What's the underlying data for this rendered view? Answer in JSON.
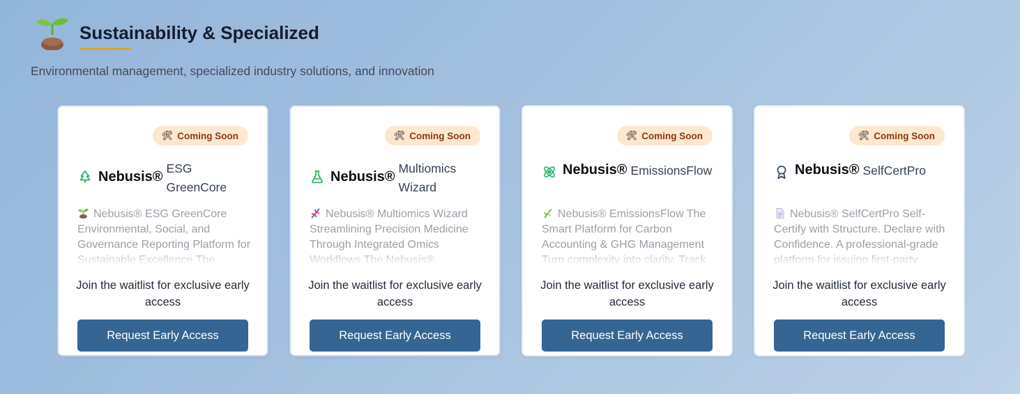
{
  "section": {
    "icon": "sprout-icon",
    "title": "Sustainability & Specialized",
    "subtitle": "Environmental management, specialized industry solutions, and innovation",
    "accent_color": "#e0a41c"
  },
  "colors": {
    "badge_bg": "#fde7cf",
    "badge_text": "#8a3b0f",
    "button_bg": "#356593",
    "icon_green": "#2fb36a"
  },
  "cards": [
    {
      "badge_icon": "tools-icon",
      "badge": "Coming Soon",
      "icon": "tree-icon",
      "brand": "Nebusis®",
      "product": "ESG GreenCore",
      "desc_icon": "sprout-icon",
      "description": "Nebusis® ESG GreenCore Environmental, Social, and Governance Reporting Platform for Sustainable Excellence The",
      "waitlist": "Join the waitlist for exclusive early access",
      "cta": "Request Early Access"
    },
    {
      "badge_icon": "tools-icon",
      "badge": "Coming Soon",
      "icon": "flask-icon",
      "brand": "Nebusis®",
      "product": "Multiomics Wizard",
      "desc_icon": "dna-icon",
      "description": "Nebusis® Multiomics Wizard Streamlining Precision Medicine Through Integrated Omics Workflows The Nebusis®",
      "waitlist": "Join the waitlist for exclusive early access",
      "cta": "Request Early Access"
    },
    {
      "badge_icon": "tools-icon",
      "badge": "Coming Soon",
      "icon": "atom-icon",
      "brand": "Nebusis®",
      "product": "EmissionsFlow",
      "desc_icon": "herb-icon",
      "description": "Nebusis® EmissionsFlow The Smart Platform for Carbon Accounting & GHG Management Turn complexity into clarity. Track",
      "waitlist": "Join the waitlist for exclusive early access",
      "cta": "Request Early Access"
    },
    {
      "badge_icon": "tools-icon",
      "badge": "Coming Soon",
      "icon": "award-icon",
      "brand": "Nebusis®",
      "product": "SelfCertPro",
      "desc_icon": "document-icon",
      "description": "Nebusis® SelfCertPro Self-Certify with Structure. Declare with Confidence. A professional-grade platform for issuing first-party",
      "waitlist": "Join the waitlist for exclusive early access",
      "cta": "Request Early Access"
    }
  ]
}
